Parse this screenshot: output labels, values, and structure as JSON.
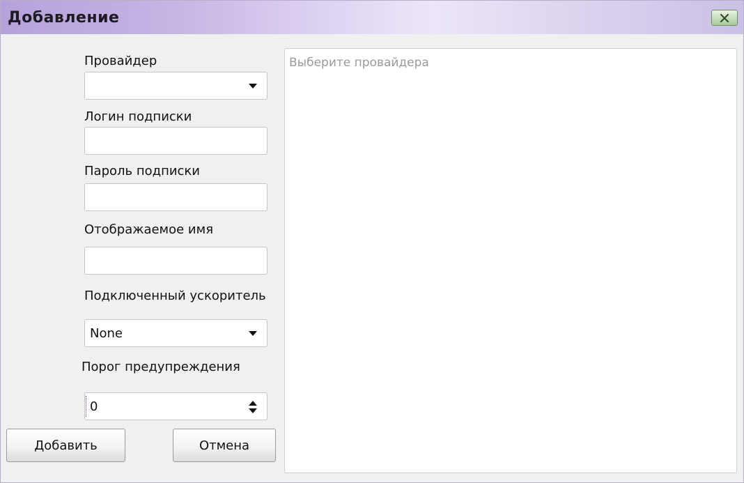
{
  "window": {
    "title": "Добавление",
    "close_icon": "close-icon"
  },
  "form": {
    "provider_label": "Провайдер",
    "provider_value": "",
    "login_label": "Логин подписки",
    "login_value": "",
    "password_label": "Пароль подписки",
    "password_value": "",
    "display_name_label": "Отображаемое имя",
    "display_name_value": "",
    "accelerator_label": "Подключенный ускоритель",
    "accelerator_value": "None",
    "threshold_label": "Порог предупреждения",
    "threshold_value": "0"
  },
  "buttons": {
    "add_label": "Добавить",
    "cancel_label": "Отмена"
  },
  "info_panel": {
    "hint": "Выберите провайдера"
  },
  "colors": {
    "titlebar_accent": "#c4b3e3",
    "window_bg": "#f0f0f0",
    "close_button": "#a9c99a"
  }
}
